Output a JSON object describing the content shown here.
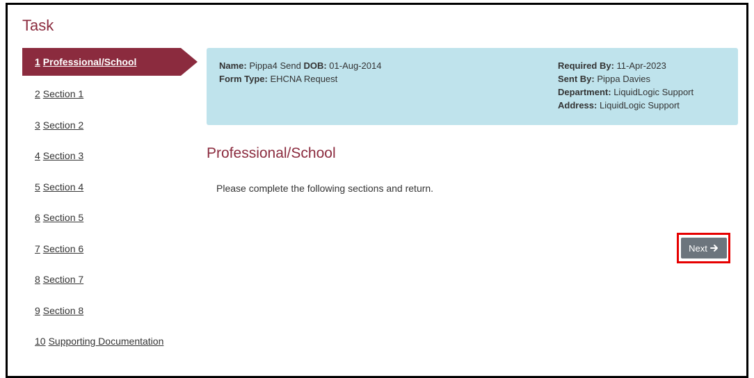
{
  "task": {
    "heading": "Task"
  },
  "nav": {
    "items": [
      {
        "num": "1",
        "label": "Professional/School",
        "active": true
      },
      {
        "num": "2",
        "label": "Section 1"
      },
      {
        "num": "3",
        "label": "Section 2"
      },
      {
        "num": "4",
        "label": "Section 3"
      },
      {
        "num": "5",
        "label": "Section 4"
      },
      {
        "num": "6",
        "label": "Section 5"
      },
      {
        "num": "7",
        "label": "Section 6"
      },
      {
        "num": "8",
        "label": "Section 7"
      },
      {
        "num": "9",
        "label": "Section 8"
      },
      {
        "num": "10",
        "label": "Supporting Documentation"
      }
    ]
  },
  "info": {
    "name_label": "Name:",
    "name_value": "Pippa4 Send",
    "dob_label": "DOB:",
    "dob_value": "01-Aug-2014",
    "form_type_label": "Form Type:",
    "form_type_value": "EHCNA Request",
    "required_by_label": "Required By:",
    "required_by_value": "11-Apr-2023",
    "sent_by_label": "Sent By:",
    "sent_by_value": "Pippa Davies",
    "department_label": "Department:",
    "department_value": "LiquidLogic Support",
    "address_label": "Address:",
    "address_value": "LiquidLogic Support"
  },
  "section": {
    "title": "Professional/School",
    "description": "Please complete the following sections and return."
  },
  "actions": {
    "next_label": "Next",
    "next_icon": "arrow-right-icon"
  },
  "colors": {
    "brand": "#8b2b3e",
    "info_bg": "#bfe3ec",
    "button_bg": "#6c757d",
    "highlight": "#e60000"
  }
}
